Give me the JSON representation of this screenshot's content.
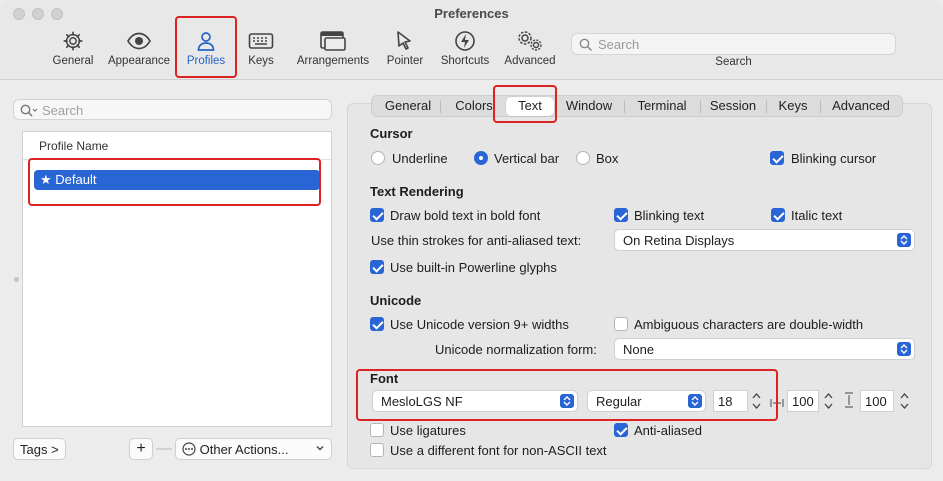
{
  "window": {
    "title": "Preferences"
  },
  "toolbar": {
    "items": [
      {
        "label": "General"
      },
      {
        "label": "Appearance"
      },
      {
        "label": "Profiles"
      },
      {
        "label": "Keys"
      },
      {
        "label": "Arrangements"
      },
      {
        "label": "Pointer"
      },
      {
        "label": "Shortcuts"
      },
      {
        "label": "Advanced"
      }
    ],
    "active": "Profiles",
    "search_placeholder": "Search",
    "search_caption": "Search"
  },
  "sidebar": {
    "search_placeholder": "Search",
    "column_header": "Profile Name",
    "profiles": [
      {
        "name": "Default",
        "star": "★",
        "selected": true
      }
    ],
    "tags_button": "Tags >",
    "add_button": "+",
    "remove_button": "—",
    "other_actions": "Other Actions..."
  },
  "tabs": {
    "items": [
      "General",
      "Colors",
      "Text",
      "Window",
      "Terminal",
      "Session",
      "Keys",
      "Advanced"
    ],
    "selected": "Text"
  },
  "cursor": {
    "heading": "Cursor",
    "options": [
      "Underline",
      "Vertical bar",
      "Box"
    ],
    "selected": "Vertical bar",
    "blinking_label": "Blinking cursor",
    "blinking_checked": true
  },
  "text_rendering": {
    "heading": "Text Rendering",
    "bold_label": "Draw bold text in bold font",
    "bold_checked": true,
    "blinking_text_label": "Blinking text",
    "blinking_text_checked": true,
    "italic_label": "Italic text",
    "italic_checked": true,
    "thin_strokes_label": "Use thin strokes for anti-aliased text:",
    "thin_strokes_value": "On Retina Displays",
    "powerline_label": "Use built-in Powerline glyphs",
    "powerline_checked": true
  },
  "unicode": {
    "heading": "Unicode",
    "v9_label": "Use Unicode version 9+ widths",
    "v9_checked": true,
    "ambiguous_label": "Ambiguous characters are double-width",
    "ambiguous_checked": false,
    "normalization_label": "Unicode normalization form:",
    "normalization_value": "None"
  },
  "font": {
    "heading": "Font",
    "family": "MesloLGS NF",
    "style": "Regular",
    "size": "18",
    "hspacing": "100",
    "vspacing": "100",
    "ligatures_label": "Use ligatures",
    "ligatures_checked": false,
    "antialiased_label": "Anti-aliased",
    "antialiased_checked": true,
    "non_ascii_label": "Use a different font for non-ASCII text",
    "non_ascii_checked": false
  },
  "colors": {
    "accent": "#2a65d6",
    "highlight_box": "#dd2222"
  }
}
